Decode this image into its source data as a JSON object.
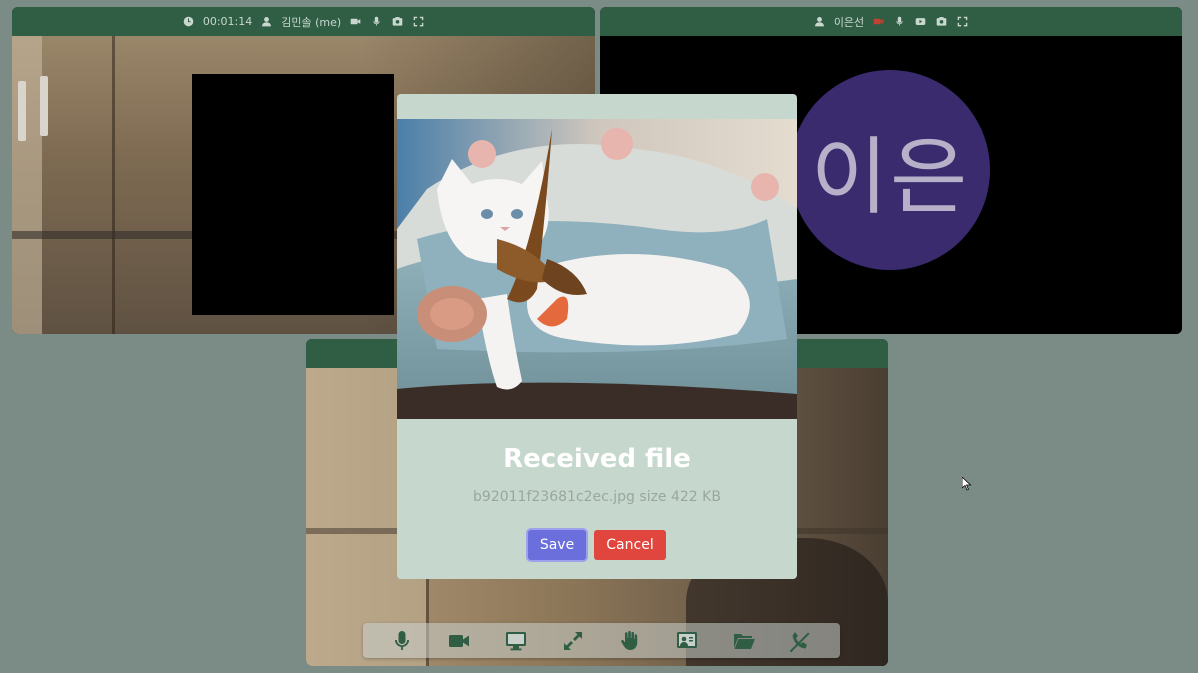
{
  "tiles": {
    "local": {
      "timer": "00:01:14",
      "name": "김민솔 (me)",
      "icons": [
        "clock-icon",
        "user-icon",
        "camera-icon",
        "mic-icon",
        "photo-icon",
        "fullscreen-icon"
      ]
    },
    "remote1": {
      "name": "이은선",
      "avatar_text": "이은",
      "avatar_color": "#3a2a6e",
      "icons": [
        "user-icon",
        "camera-off-icon",
        "mic-icon",
        "youtube-icon",
        "photo-icon",
        "fullscreen-icon"
      ]
    },
    "remote2": {
      "header_color": "#2f5e44"
    }
  },
  "modal": {
    "title": "Received file",
    "subtitle": "b92011f23681c2ec.jpg size 422 KB",
    "save_label": "Save",
    "cancel_label": "Cancel",
    "image_icon": "cat-photo"
  },
  "toolbar": {
    "buttons": [
      {
        "name": "mic-button",
        "icon": "mic-icon"
      },
      {
        "name": "video-button",
        "icon": "video-icon"
      },
      {
        "name": "screen-share-button",
        "icon": "monitor-icon"
      },
      {
        "name": "fullscreen-button",
        "icon": "expand-icon"
      },
      {
        "name": "raise-hand-button",
        "icon": "hand-icon"
      },
      {
        "name": "whiteboard-button",
        "icon": "whiteboard-icon"
      },
      {
        "name": "file-share-button",
        "icon": "folder-icon"
      },
      {
        "name": "leave-call-button",
        "icon": "phone-off-icon"
      }
    ]
  },
  "colors": {
    "background": "#7b8c86",
    "header": "#2f5e44",
    "save": "#6a6fdc",
    "cancel": "#e0463e",
    "modal": "#c6d8cd"
  }
}
